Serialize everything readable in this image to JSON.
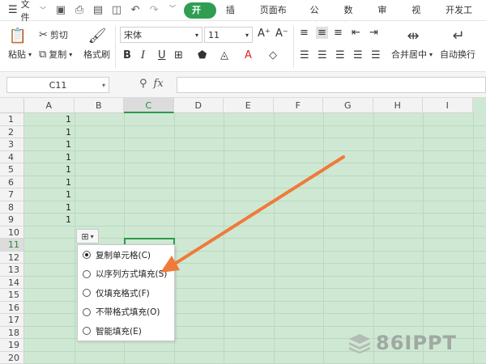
{
  "menubar": {
    "file_label": "文件",
    "tabs": [
      "开始",
      "插入",
      "页面布局",
      "公式",
      "数据",
      "审阅",
      "视图",
      "开发工具"
    ]
  },
  "ribbon": {
    "cut_label": "剪切",
    "paste_label": "粘贴",
    "copy_label": "复制",
    "format_painter_label": "格式刷",
    "font_name": "宋体",
    "font_size": "11",
    "merge_label": "合并居中",
    "wrap_label": "自动换行"
  },
  "formula_bar": {
    "name_box": "C11",
    "fx_label": "fx"
  },
  "sheet": {
    "columns": [
      "A",
      "B",
      "C",
      "D",
      "E",
      "F",
      "G",
      "H",
      "I"
    ],
    "rows": [
      "1",
      "2",
      "3",
      "4",
      "5",
      "6",
      "7",
      "8",
      "9",
      "10",
      "11",
      "12",
      "13",
      "14",
      "15",
      "16",
      "17",
      "18",
      "19",
      "20"
    ],
    "selected_column": "C",
    "selected_row": "11",
    "column_a_values": [
      "1",
      "1",
      "1",
      "1",
      "1",
      "1",
      "1",
      "1",
      "1"
    ]
  },
  "fill_menu": {
    "options": [
      {
        "label": "复制单元格(C)",
        "checked": true
      },
      {
        "label": "以序列方式填充(S)",
        "checked": false
      },
      {
        "label": "仅填充格式(F)",
        "checked": false
      },
      {
        "label": "不带格式填充(O)",
        "checked": false
      },
      {
        "label": "智能填充(E)",
        "checked": false
      }
    ]
  },
  "watermark": {
    "text": "86IPPT"
  },
  "colors": {
    "accent": "#2f9e52",
    "sheet_bg": "#cfe8d3",
    "arrow": "#f07a3a"
  }
}
